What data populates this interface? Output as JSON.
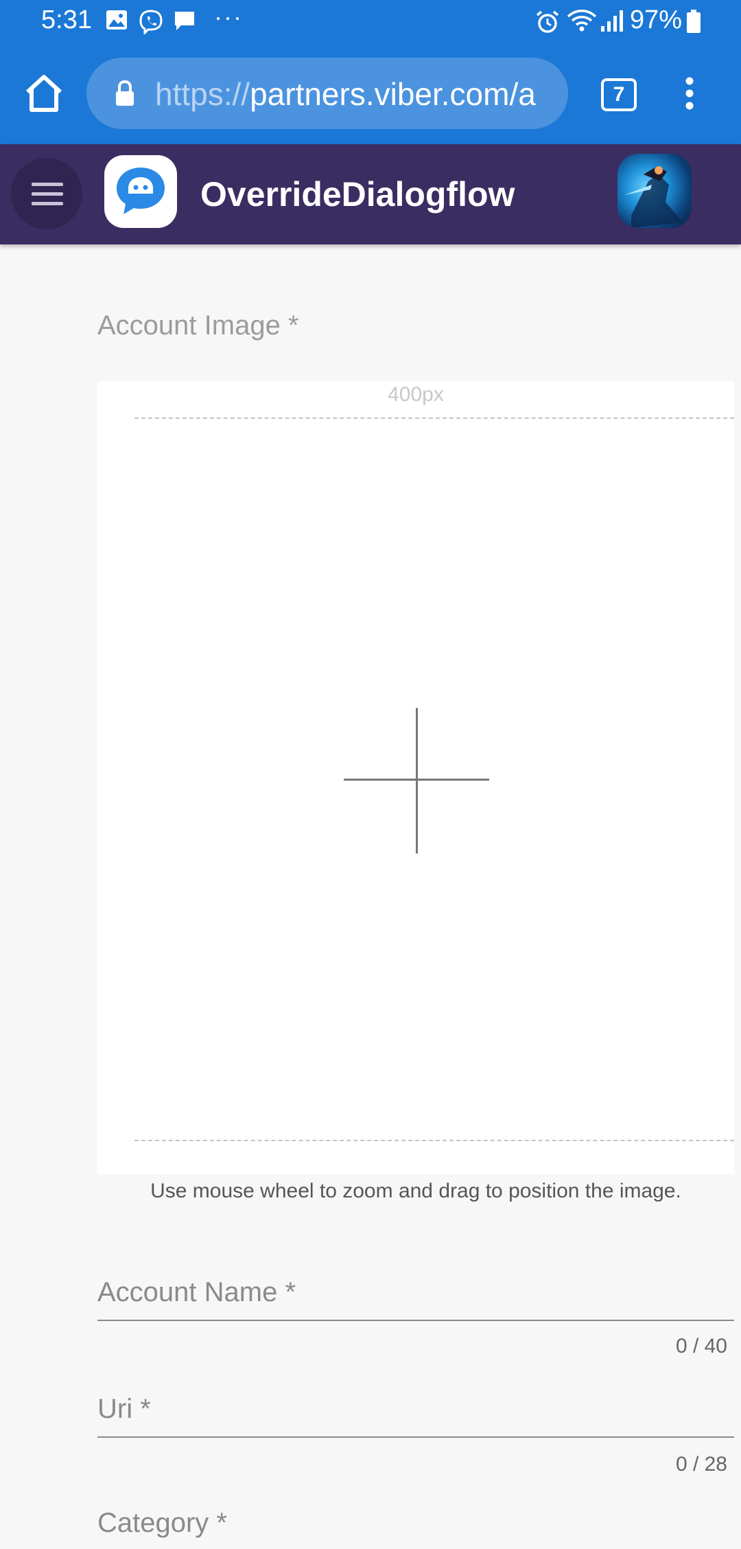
{
  "status_bar": {
    "time": "5:31",
    "battery": "97%",
    "more_indicator": "···",
    "icons": [
      "gallery-icon",
      "viber-icon",
      "message-icon",
      "alarm-icon",
      "wifi-icon",
      "signal-icon",
      "battery-icon"
    ]
  },
  "browser": {
    "url_scheme": "https://",
    "url_rest": "partners.viber.com/a",
    "tab_count": "7"
  },
  "app": {
    "title": "OverrideDialogflow",
    "header_color": "#3a2d61",
    "accent_color": "#1b78d6"
  },
  "form": {
    "image_label": "Account Image *",
    "image_size_label": "400px",
    "image_hint": "Use mouse wheel to zoom and drag to position the image.",
    "name_placeholder": "Account Name *",
    "name_counter": "0 / 40",
    "uri_placeholder": "Uri *",
    "uri_counter": "0 / 28",
    "category_placeholder": "Category *"
  }
}
